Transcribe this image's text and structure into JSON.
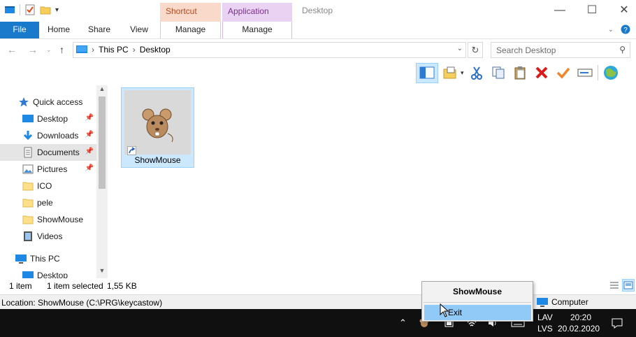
{
  "window": {
    "title": "Desktop",
    "context_tabs": {
      "shortcut_tools": "Shortcut Tools",
      "application_tools": "Application Tools"
    }
  },
  "ribbon": {
    "tabs": [
      "File",
      "Home",
      "Share",
      "View"
    ],
    "manage1": "Manage",
    "manage2": "Manage"
  },
  "address": {
    "path": [
      "This PC",
      "Desktop"
    ],
    "search_placeholder": "Search Desktop"
  },
  "nav": {
    "items": [
      {
        "label": "Quick access",
        "icon": "star-icon"
      },
      {
        "label": "Desktop",
        "icon": "desktop-icon",
        "pinned": true
      },
      {
        "label": "Downloads",
        "icon": "download-icon",
        "pinned": true
      },
      {
        "label": "Documents",
        "icon": "documents-icon",
        "pinned": true,
        "selected": true
      },
      {
        "label": "Pictures",
        "icon": "pictures-icon",
        "pinned": true
      },
      {
        "label": "ICO",
        "icon": "folder-icon"
      },
      {
        "label": "pele",
        "icon": "folder-icon"
      },
      {
        "label": "ShowMouse",
        "icon": "folder-icon"
      },
      {
        "label": "Videos",
        "icon": "videos-icon"
      },
      {
        "label": "This PC",
        "icon": "computer-icon"
      },
      {
        "label": "Desktop",
        "icon": "desktop-icon"
      }
    ]
  },
  "content": {
    "file_name": "ShowMouse"
  },
  "status": {
    "count": "1 item",
    "selected": "1 item selected",
    "size": "1,55 KB"
  },
  "location": {
    "text": "Location: ShowMouse (C:\\PRG\\keycastow)",
    "zone": "Computer"
  },
  "context_menu": {
    "header": "ShowMouse",
    "item": "Exit"
  },
  "taskbar": {
    "lang1": "LAV",
    "lang2": "LVS",
    "time": "20:20",
    "date": "20.02.2020"
  },
  "colors": {
    "file_tab": "#1979ca",
    "selection": "#cce8ff",
    "menu_highlight": "#91c9f7",
    "taskbar": "#101010"
  }
}
